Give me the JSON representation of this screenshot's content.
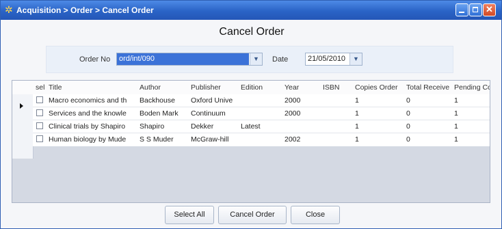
{
  "window": {
    "title": "Acquisition > Order > Cancel Order",
    "app_icon": "gear-star-icon"
  },
  "heading": "Cancel Order",
  "form": {
    "order_no_label": "Order No",
    "order_no_value": "ord/int/090",
    "date_label": "Date",
    "date_value": "21/05/2010"
  },
  "grid": {
    "columns": [
      "sel",
      "Title",
      "Author",
      "Publisher",
      "Edition",
      "Year",
      "ISBN",
      "Copies Order",
      "Total Receive",
      "Pending Co"
    ],
    "rows": [
      {
        "title": "Macro economics and th",
        "author": "Backhouse",
        "publisher": "Oxford Unive",
        "edition": "",
        "year": "2000",
        "isbn": "",
        "copies_order": "1",
        "total_receive": "0",
        "pending": "1"
      },
      {
        "title": "Services and the knowle",
        "author": "Boden Mark",
        "publisher": "Continuum",
        "edition": "",
        "year": "2000",
        "isbn": "",
        "copies_order": "1",
        "total_receive": "0",
        "pending": "1"
      },
      {
        "title": "Clinical trials by Shapiro",
        "author": "Shapiro",
        "publisher": "Dekker",
        "edition": "Latest",
        "year": "",
        "isbn": "",
        "copies_order": "1",
        "total_receive": "0",
        "pending": "1"
      },
      {
        "title": "Human biology by Mude",
        "author": "S S Muder",
        "publisher": "McGraw-hill",
        "edition": "",
        "year": "2002",
        "isbn": "",
        "copies_order": "1",
        "total_receive": "0",
        "pending": "1"
      }
    ]
  },
  "buttons": {
    "select_all": "Select All",
    "cancel_order": "Cancel Order",
    "close": "Close"
  }
}
